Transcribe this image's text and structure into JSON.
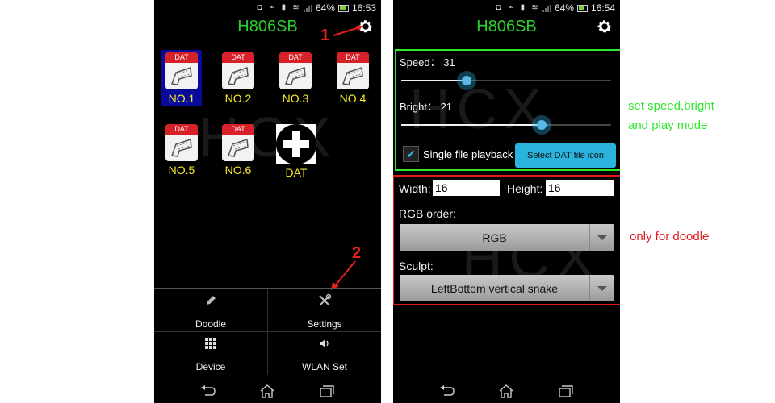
{
  "left_screen": {
    "status": {
      "battery": "64%",
      "time": "16:53"
    },
    "title": "H806SB",
    "files": [
      {
        "label": "NO.1",
        "badge": "DAT",
        "selected": true
      },
      {
        "label": "NO.2",
        "badge": "DAT",
        "selected": false
      },
      {
        "label": "NO.3",
        "badge": "DAT",
        "selected": false
      },
      {
        "label": "NO.4",
        "badge": "DAT",
        "selected": false
      },
      {
        "label": "NO.5",
        "badge": "DAT",
        "selected": false
      },
      {
        "label": "NO.6",
        "badge": "DAT",
        "selected": false
      }
    ],
    "add_tile_label": "DAT",
    "watermark": "HCX",
    "annotations": {
      "step1": "1",
      "step2": "2"
    },
    "menu": [
      {
        "label": "Doodle",
        "icon": "pencil-icon"
      },
      {
        "label": "Settings",
        "icon": "wrench-screwdriver-icon"
      },
      {
        "label": "Device",
        "icon": "grid-icon"
      },
      {
        "label": "WLAN Set",
        "icon": "speaker-icon"
      }
    ]
  },
  "right_screen": {
    "status": {
      "battery": "64%",
      "time": "16:54"
    },
    "title": "H806SB",
    "watermark": "HCX",
    "speed": {
      "label": "Speed： 31",
      "value": 31,
      "fraction": 0.31
    },
    "bright": {
      "label": "Bright： 21",
      "value": 21,
      "fraction": 0.67
    },
    "single_file_playback": {
      "label": "Single file playback",
      "checked": true
    },
    "select_dat_button": "Select DAT file icon",
    "width": {
      "label": "Width:",
      "value": "16"
    },
    "height": {
      "label": "Height:",
      "value": "16"
    },
    "rgb_order": {
      "label": "RGB order:",
      "selected": "RGB"
    },
    "sculpt": {
      "label": "Sculpt:",
      "selected": "LeftBottom vertical snake"
    }
  },
  "notes": {
    "green": "set speed,bright\nand play mode",
    "green_line1": "set speed,bright",
    "green_line2": "and play mode",
    "red": "only for doodle",
    "green_color": "#2ee82e",
    "red_color": "#e01a1a"
  }
}
